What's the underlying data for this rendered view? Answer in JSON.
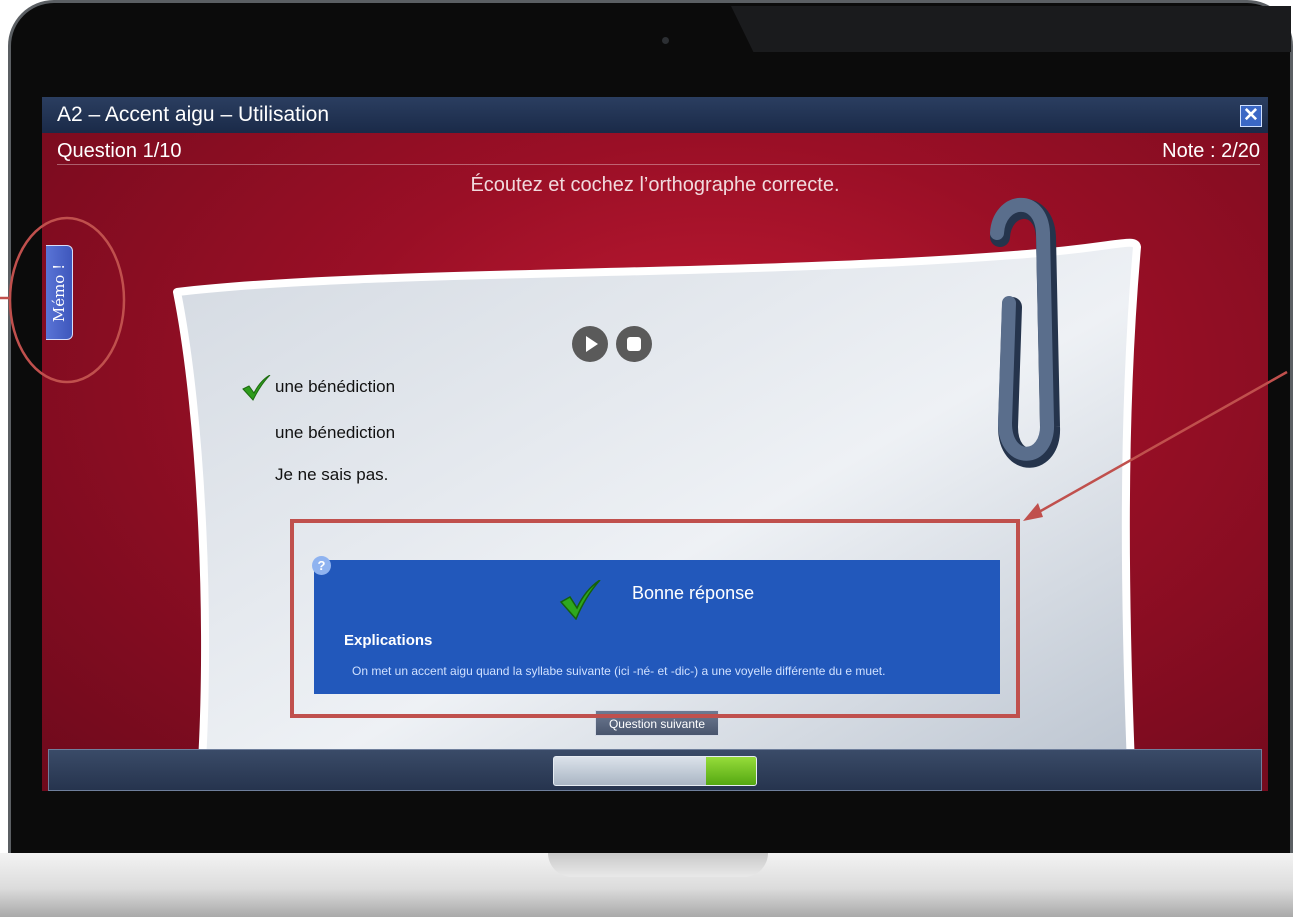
{
  "window": {
    "title": "A2 – Accent aigu – Utilisation",
    "close_label": "✕"
  },
  "header": {
    "question_counter": "Question 1/10",
    "score": "Note : 2/20",
    "instruction": "Écoutez et cochez l’orthographe correcte."
  },
  "memo": {
    "label": "Mémo !"
  },
  "audio": {
    "play_icon": "play-icon",
    "stop_icon": "stop-icon"
  },
  "options": [
    {
      "label": "une bénédiction",
      "checked": true
    },
    {
      "label": "une bénediction",
      "checked": false
    },
    {
      "label": "Je ne sais pas.",
      "checked": false
    }
  ],
  "feedback": {
    "help_icon_label": "?",
    "title": "Bonne réponse",
    "explanation_heading": "Explications",
    "explanation_text": "On met un accent aigu quand la syllabe suivante (ici -né- et -dic-) a une voyelle différente du e muet."
  },
  "next_button": {
    "label": "Question suivante"
  },
  "progress": {
    "fraction": 0.25
  },
  "colors": {
    "feedback_panel": "#2258bb",
    "check_green": "#2e9c1c",
    "annotation_red": "#c0504d",
    "progress_green": "#7ccc2a"
  }
}
